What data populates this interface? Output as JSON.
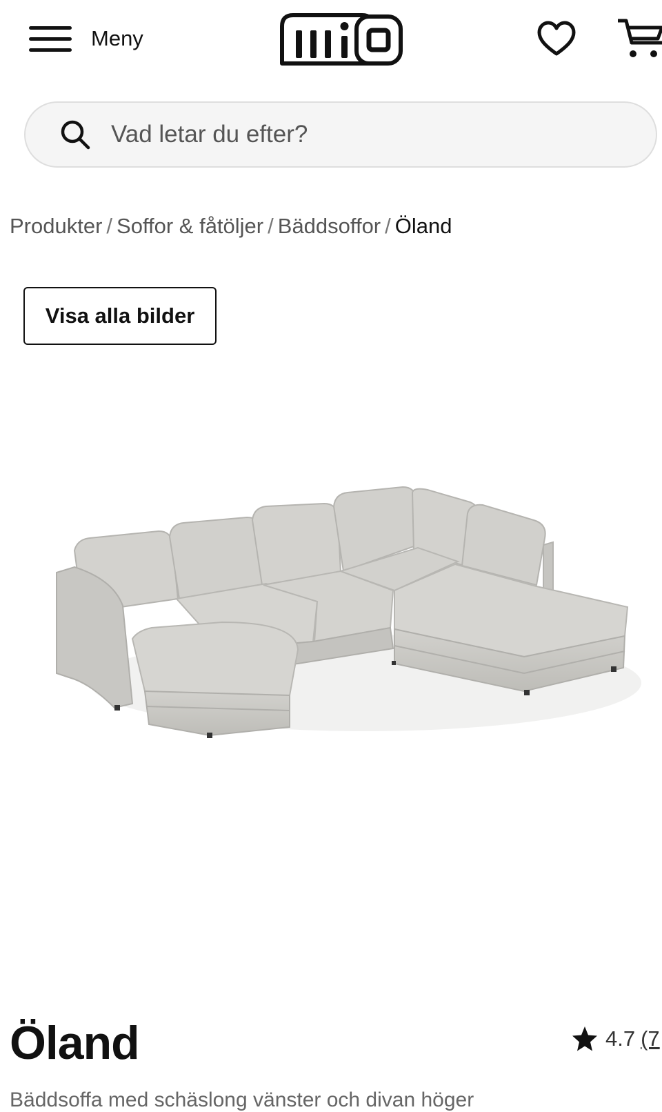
{
  "header": {
    "menu_label": "Meny",
    "logo_text": "mio",
    "favorites_icon": "heart-icon",
    "cart_icon": "cart-icon"
  },
  "search": {
    "placeholder": "Vad letar du efter?",
    "icon": "search-icon"
  },
  "breadcrumb": {
    "items": [
      "Produkter",
      "Soffor & fåtöljer",
      "Bäddsoffor"
    ],
    "current": "Öland",
    "separator": "/"
  },
  "gallery": {
    "show_all_label": "Visa alla bilder"
  },
  "product": {
    "title": "Öland",
    "rating": "4.7",
    "reviews": "(7",
    "subtitle": "Bäddsoffa med schäslong vänster och divan höger",
    "sofa_color": "#cdccc8"
  }
}
